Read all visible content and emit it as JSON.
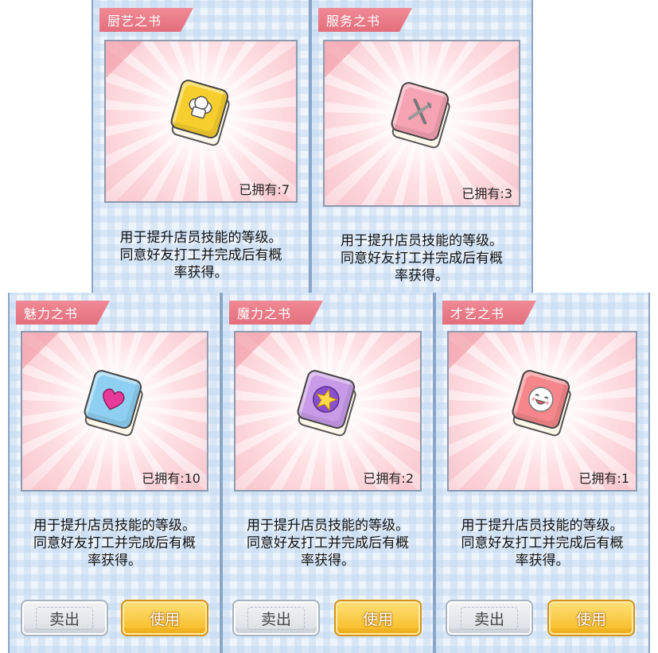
{
  "cards": [
    {
      "title": "厨艺之书",
      "owned": "已拥有:7",
      "desc1": "用于提升店员技能的等级。",
      "desc2": "同意好友打工并完成后有概",
      "desc3": "率获得。",
      "book_color": "#f6cf2e",
      "emblem": "chef-hat-icon"
    },
    {
      "title": "服务之书",
      "owned": "已拥有:3",
      "desc1": "用于提升店员技能的等级。",
      "desc2": "同意好友打工并完成后有概",
      "desc3": "率获得。",
      "book_color": "#f6a3b4",
      "emblem": "fork-knife-icon"
    },
    {
      "title": "魅力之书",
      "owned": "已拥有:10",
      "desc1": "用于提升店员技能的等级。",
      "desc2": "同意好友打工并完成后有概",
      "desc3": "率获得。",
      "sell_label": "卖出",
      "use_label": "使用",
      "book_color": "#8fd0f2",
      "emblem": "heart-icon"
    },
    {
      "title": "魔力之书",
      "owned": "已拥有:2",
      "desc1": "用于提升店员技能的等级。",
      "desc2": "同意好友打工并完成后有概",
      "desc3": "率获得。",
      "sell_label": "卖出",
      "use_label": "使用",
      "book_color": "#c89be8",
      "emblem": "star-icon"
    },
    {
      "title": "才艺之书",
      "owned": "已拥有:1",
      "desc1": "用于提升店员技能的等级。",
      "desc2": "同意好友打工并完成后有概",
      "desc3": "率获得。",
      "sell_label": "卖出",
      "use_label": "使用",
      "book_color": "#f5878c",
      "emblem": "smiley-face-icon"
    }
  ]
}
